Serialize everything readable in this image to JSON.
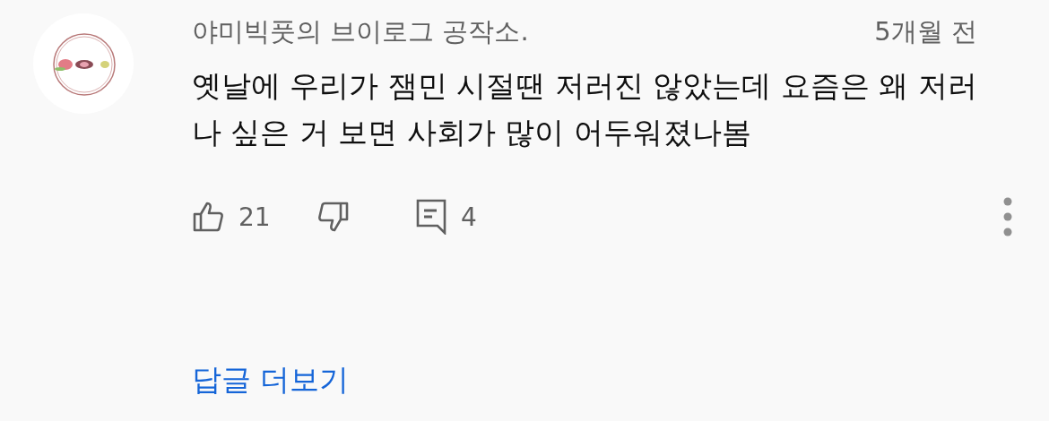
{
  "comment": {
    "author": "야미빅풋의 브이로그 공작소.",
    "time": "5개월 전",
    "text": "옛날에 우리가 잼민 시절땐 저러진 않았는데 요즘은 왜 저러나 싶은 거 보면 사회가 많이 어두워졌나봄",
    "likes": "21",
    "replies_count": "4",
    "more_replies": "답글 더보기"
  }
}
